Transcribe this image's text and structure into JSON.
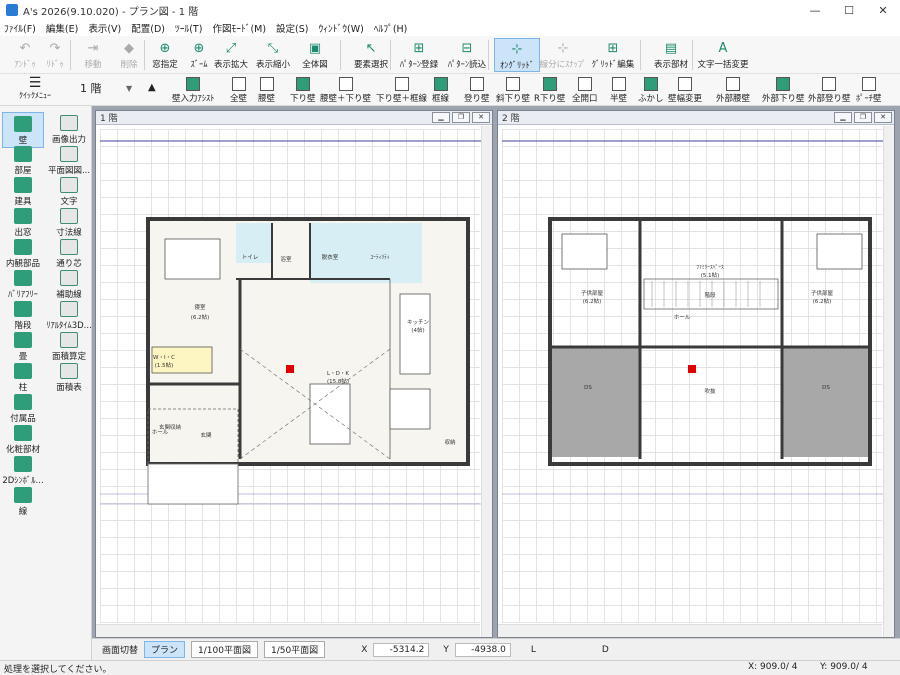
{
  "window": {
    "title": "A's 2026(9.10.020) - プラン図 - 1 階",
    "min": "—",
    "max": "☐",
    "close": "✕"
  },
  "menu": [
    "ﾌｧｲﾙ(F)",
    "編集(E)",
    "表示(V)",
    "配置(D)",
    "ﾂｰﾙ(T)",
    "作図ﾓｰﾄﾞ(M)",
    "設定(S)",
    "ｳｨﾝﾄﾞｳ(W)",
    "ﾍﾙﾌﾟ(H)"
  ],
  "toolbar1": [
    {
      "label": "ｱﾝﾄﾞｩ",
      "icon": "undo-icon",
      "g": "↶",
      "enabled": false
    },
    {
      "label": "ﾘﾄﾞｩ",
      "icon": "redo-icon",
      "g": "↷",
      "enabled": false
    },
    {
      "label": "移動",
      "icon": "move-icon",
      "g": "⇥",
      "enabled": false
    },
    {
      "label": "削除",
      "icon": "eraser-icon",
      "g": "◆",
      "enabled": false
    },
    {
      "label": "窓指定",
      "icon": "window-zoom-icon",
      "g": "⊕",
      "enabled": true
    },
    {
      "label": "ｽﾞｰﾑ",
      "icon": "zoom-icon",
      "g": "⊕",
      "enabled": true
    },
    {
      "label": "表示拡大",
      "icon": "zoom-in-icon",
      "g": "⤢",
      "enabled": true
    },
    {
      "label": "表示縮小",
      "icon": "zoom-out-icon",
      "g": "⤡",
      "enabled": true
    },
    {
      "label": "全体図",
      "icon": "fit-all-icon",
      "g": "▣",
      "enabled": true
    },
    {
      "label": "要素選択",
      "icon": "cursor-icon",
      "g": "↖",
      "enabled": true
    },
    {
      "label": "ﾊﾟﾀｰﾝ登録",
      "icon": "pattern-register-icon",
      "g": "⊞",
      "enabled": true
    },
    {
      "label": "ﾊﾟﾀｰﾝ読込",
      "icon": "pattern-load-icon",
      "g": "⊟",
      "enabled": true
    },
    {
      "label": "ｵﾝｸﾞﾘｯﾄﾞ",
      "icon": "on-grid-icon",
      "g": "⊹",
      "enabled": true,
      "active": true
    },
    {
      "label": "線分にｽﾅｯﾌﾟ",
      "icon": "snap-line-icon",
      "g": "⊹",
      "enabled": false
    },
    {
      "label": "ｸﾞﾘｯﾄﾞ編集",
      "icon": "grid-edit-icon",
      "g": "⊞",
      "enabled": true
    },
    {
      "label": "表示部材",
      "icon": "display-parts-icon",
      "g": "▤",
      "enabled": true
    },
    {
      "label": "文字一括変更",
      "icon": "text-replace-icon",
      "g": "A",
      "enabled": true
    }
  ],
  "quickmenu": "ｸｲｯｸﾒﾆｭｰ",
  "floor": {
    "value": "1 階"
  },
  "toolbar2": [
    "壁入力ｱｼｽﾄ",
    "全壁",
    "腰壁",
    "下り壁",
    "腰壁＋下り壁",
    "下り壁＋框線",
    "框線",
    "登り壁",
    "斜下り壁",
    "R下り壁",
    "全開口",
    "半壁",
    "ふかし",
    "壁幅変更",
    "外部腰壁",
    "外部下り壁",
    "外部登り壁",
    "ﾎﾟｰﾁ壁"
  ],
  "sidebar": [
    [
      "壁",
      "画像出力"
    ],
    [
      "部屋",
      "平面図図..."
    ],
    [
      "建具",
      "文字"
    ],
    [
      "出窓",
      "寸法線"
    ],
    [
      "内観部品",
      "通り芯"
    ],
    [
      "ﾊﾞﾘｱﾌﾘｰ",
      "補助線"
    ],
    [
      "階段",
      "ﾘｱﾙﾀｲﾑ3D..."
    ],
    [
      "畳",
      "面積算定"
    ],
    [
      "柱",
      "面積表"
    ],
    [
      "付属品",
      ""
    ],
    [
      "化粧部材",
      ""
    ],
    [
      "2Dｼﾝﾎﾞﾙ...",
      ""
    ],
    [
      "線",
      ""
    ]
  ],
  "panes": [
    {
      "title": "1 階"
    },
    {
      "title": "2 階"
    }
  ],
  "plan1": {
    "rooms": [
      "トイレ",
      "浴室",
      "脱衣室",
      "ﾕｰﾃｨﾘﾃｨ",
      "寝室",
      "(6.2帖)",
      "W・I・C",
      "(1.5帖)",
      "キッチン",
      "(4帖)",
      "L・D・K",
      "(15.8帖)",
      "玄関",
      "ホール",
      "収納",
      "玄関収納"
    ]
  },
  "plan2": {
    "rooms": [
      "ﾌｧﾐﾘｰｽﾍﾟｰｽ",
      "(5.1帖)",
      "子供部屋",
      "(6.2帖)",
      "子供部屋",
      "(6.2帖)",
      "階段",
      "ホール",
      "DS",
      "吹抜",
      "DS"
    ]
  },
  "status": {
    "switch": "画面切替",
    "plan": "プラン",
    "p100": "1/100平面図",
    "p50": "1/50平面図",
    "x_label": "X",
    "x": "-5314.2",
    "y_label": "Y",
    "y": "-4938.0",
    "l_label": "L",
    "d_label": "D"
  },
  "bottom": {
    "message": "処理を選択してください。",
    "xscale": "X: 909.0/ 4",
    "yscale": "Y: 909.0/ 4"
  },
  "colors": {
    "wall": "#3a3a3a",
    "wet": "#d6eef4",
    "wic": "#fdf6c2",
    "ds": "#a8a8a8",
    "marker": "#e00000",
    "accent": "#2f9d7a"
  }
}
